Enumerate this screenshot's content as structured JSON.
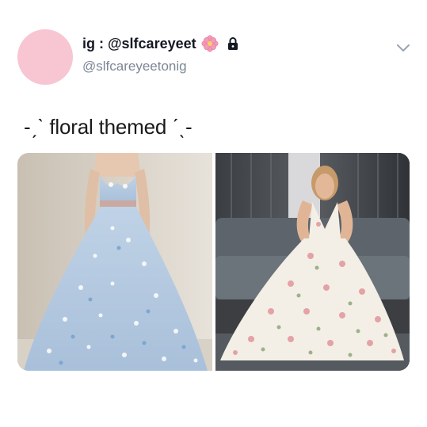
{
  "tweet": {
    "display_name": "ig : @slfcareyeet",
    "handle": "@slfcareyeetonig",
    "text": "-ˏˋ floral themed ˊˎ-"
  },
  "icons": {
    "name_emoji": "flower-icon",
    "private": "lock-icon",
    "menu": "chevron-down-icon"
  },
  "colors": {
    "avatar": "#f7c6d2",
    "handle": "#7c8794",
    "text": "#1a1a1a"
  }
}
